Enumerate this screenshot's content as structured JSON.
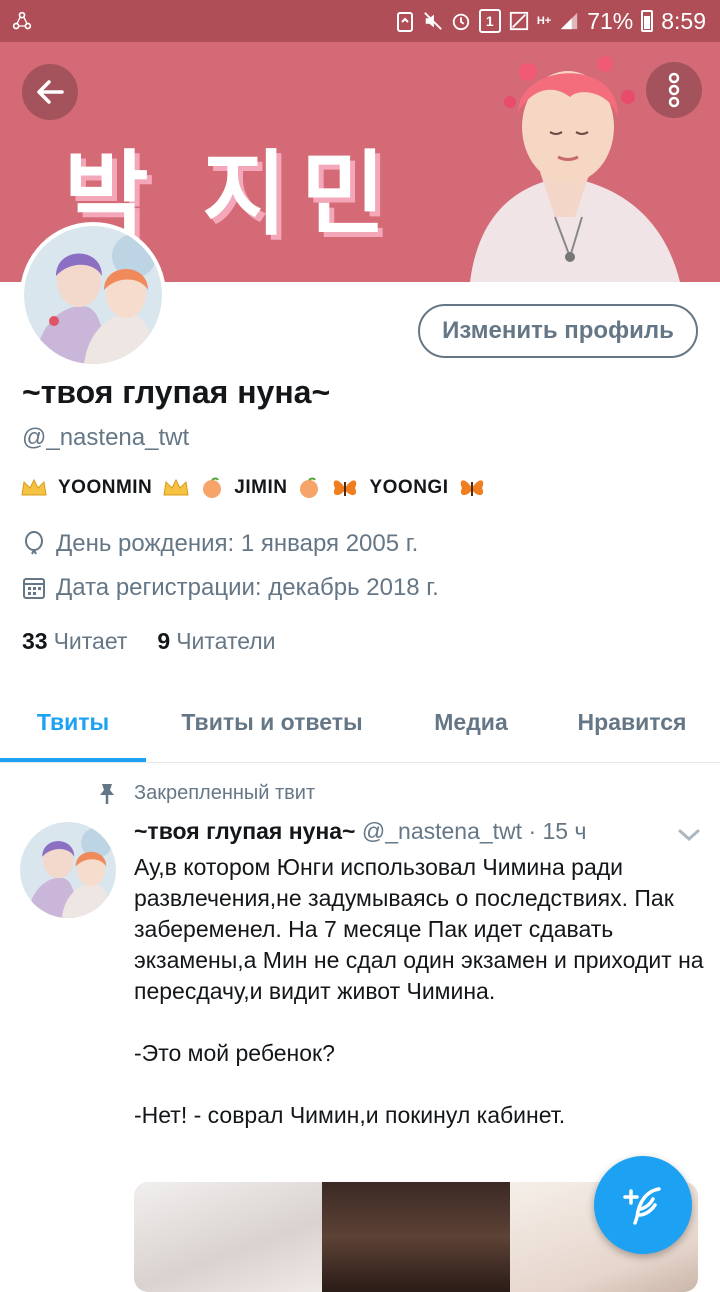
{
  "status_bar": {
    "sim_slot": "1",
    "network": "H+",
    "battery": "71%",
    "time": "8:59"
  },
  "header": {
    "banner_text": "박 지민"
  },
  "profile": {
    "edit_button": "Изменить профиль",
    "display_name": "~твоя глупая нуна~",
    "handle": "@_nastena_twt",
    "bio": {
      "part1": "YOONMIN",
      "part2": "JIMIN",
      "part3": "YOONGI"
    },
    "birthday": "День рождения: 1 января 2005 г.",
    "joined": "Дата регистрации: декабрь 2018 г.",
    "following_count": "33",
    "following_label": "Читает",
    "followers_count": "9",
    "followers_label": "Читатели"
  },
  "tabs": [
    {
      "label": "Твиты"
    },
    {
      "label": "Твиты и ответы"
    },
    {
      "label": "Медиа"
    },
    {
      "label": "Нравится"
    }
  ],
  "tweet": {
    "pinned_label": "Закрепленный твит",
    "author_name": "~твоя глупая нуна~",
    "author_handle": "@_nastena_twt",
    "time": "· 15 ч",
    "text": "Ау,в котором Юнги использовал Чимина ради развлечения,не задумываясь о последствиях. Пак забеременел. На 7 месяце Пак идет сдавать экзамены,а Мин не сдал один экзамен и приходит на пересдачу,и видит живот Чимина.\n\n-Это мой ребенок?\n\n-Нет! - соврал Чимин,и покинул кабинет."
  },
  "colors": {
    "accent": "#1da1f2",
    "banner": "#d36a76",
    "status_bar": "#b04e58",
    "secondary_text": "#657786"
  }
}
